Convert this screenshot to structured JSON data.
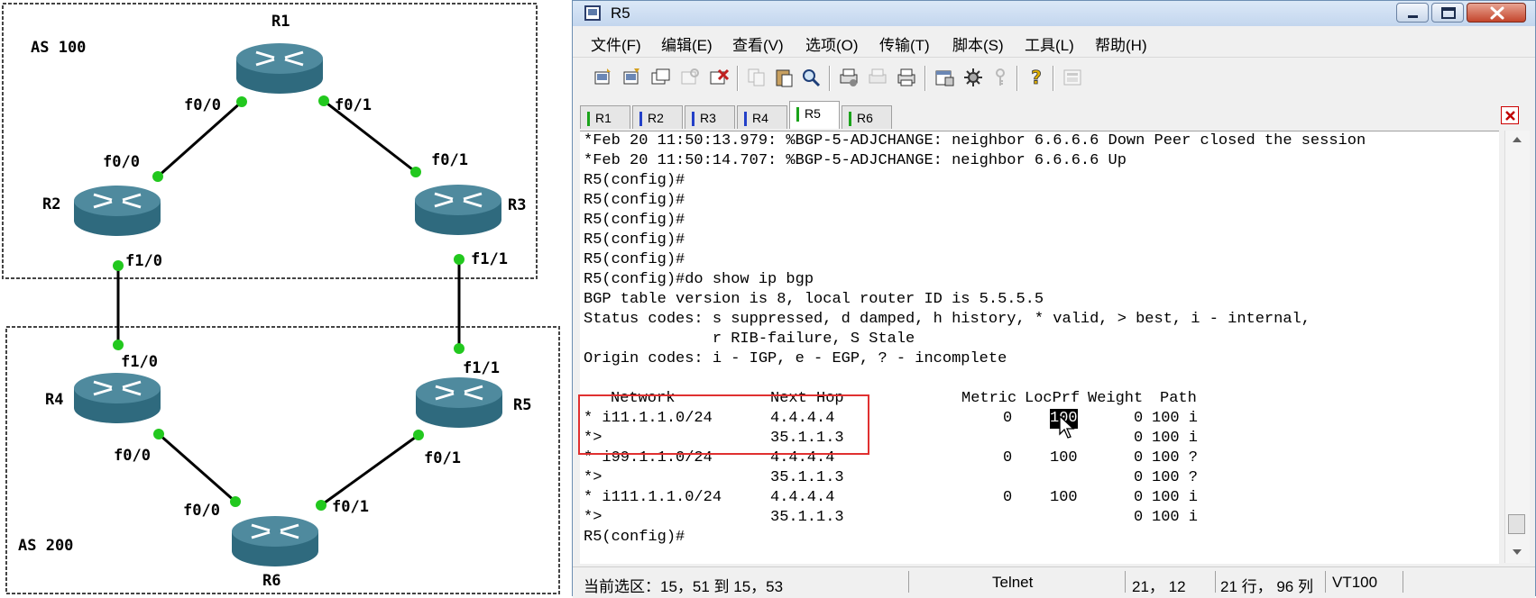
{
  "topology": {
    "as_labels": [
      "AS 100",
      "AS 200"
    ],
    "routers": [
      "R1",
      "R2",
      "R3",
      "R4",
      "R5",
      "R6"
    ],
    "interfaces": {
      "r1_f00": "f0/0",
      "r1_f01": "f0/1",
      "r2_f00": "f0/0",
      "r2_f10": "f1/0",
      "r3_f01": "f0/1",
      "r3_f11": "f1/1",
      "r4_f10": "f1/0",
      "r4_f00": "f0/0",
      "r5_f11": "f1/1",
      "r5_f01": "f0/1",
      "r6_f00": "f0/0",
      "r6_f01": "f0/1"
    },
    "colors": {
      "router_body": "#4f8a9e",
      "port": "#22c81e",
      "link": "#000000",
      "as_box": "#444444"
    }
  },
  "window": {
    "title": "R5",
    "icon": "app-window-icon",
    "controls": [
      "minimize-icon",
      "maximize-icon",
      "close-icon"
    ]
  },
  "menu": [
    "文件(F)",
    "编辑(E)",
    "查看(V)",
    "选项(O)",
    "传输(T)",
    "脚本(S)",
    "工具(L)",
    "帮助(H)"
  ],
  "toolbar": {
    "icons": [
      "connect-icon",
      "quick-connect-icon",
      "connect-tab-icon",
      "reconnect-icon",
      "disconnect-icon",
      "copy-icon",
      "paste-icon",
      "find-icon",
      "print-setup-icon",
      "print-selection-icon",
      "print-icon",
      "session-options-icon",
      "settings-icon",
      "key-icon",
      "help-icon",
      "keymap-icon"
    ]
  },
  "tabs": [
    {
      "label": "R1",
      "color": "#1aa31a"
    },
    {
      "label": "R2",
      "color": "#2340c8"
    },
    {
      "label": "R3",
      "color": "#2340c8"
    },
    {
      "label": "R4",
      "color": "#2340c8"
    },
    {
      "label": "R5",
      "color": "#1aa31a"
    },
    {
      "label": "R6",
      "color": "#1aa31a"
    }
  ],
  "active_tab": "R5",
  "terminal": {
    "lines": [
      "*Feb 20 11:50:13.979: %BGP-5-ADJCHANGE: neighbor 6.6.6.6 Down Peer closed the session",
      "*Feb 20 11:50:14.707: %BGP-5-ADJCHANGE: neighbor 6.6.6.6 Up",
      "R5(config)#",
      "R5(config)#",
      "R5(config)#",
      "R5(config)#",
      "R5(config)#",
      "R5(config)#do show ip bgp",
      "BGP table version is 8, local router ID is 5.5.5.5",
      "Status codes: s suppressed, d damped, h history, * valid, > best, i - internal,",
      "              r RIB-failure, S Stale",
      "Origin codes: i - IGP, e - EGP, ? - incomplete",
      ""
    ],
    "bgp_table": {
      "headers": {
        "network": "Network",
        "next_hop": "Next Hop",
        "metric": "Metric",
        "locprf": "LocPrf",
        "weight": "Weight",
        "path": "Path"
      },
      "rows": [
        {
          "network": "* i11.1.1.0/24",
          "next_hop": "4.4.4.4",
          "metric": "0",
          "locprf": "100",
          "weight": "0",
          "path": "100 i"
        },
        {
          "network": "*>",
          "next_hop": "35.1.1.3",
          "metric": "",
          "locprf": "",
          "weight": "0",
          "path": "100 i"
        },
        {
          "network": "* i99.1.1.0/24",
          "next_hop": "4.4.4.4",
          "metric": "0",
          "locprf": "100",
          "weight": "0",
          "path": "100 ?"
        },
        {
          "network": "*>",
          "next_hop": "35.1.1.3",
          "metric": "",
          "locprf": "",
          "weight": "0",
          "path": "100 ?"
        },
        {
          "network": "* i111.1.1.0/24",
          "next_hop": "4.4.4.4",
          "metric": "0",
          "locprf": "100",
          "weight": "0",
          "path": "100 i"
        },
        {
          "network": "*>",
          "next_hop": "35.1.1.3",
          "metric": "",
          "locprf": "",
          "weight": "0",
          "path": "100 i"
        }
      ]
    },
    "prompt": "R5(config)#",
    "highlight_color": "#e03030"
  },
  "status": {
    "selection": "当前选区：15，51 到 15，53",
    "protocol": "Telnet",
    "cursor": "21， 12",
    "size": "21 行， 96 列",
    "emulation": "VT100"
  }
}
